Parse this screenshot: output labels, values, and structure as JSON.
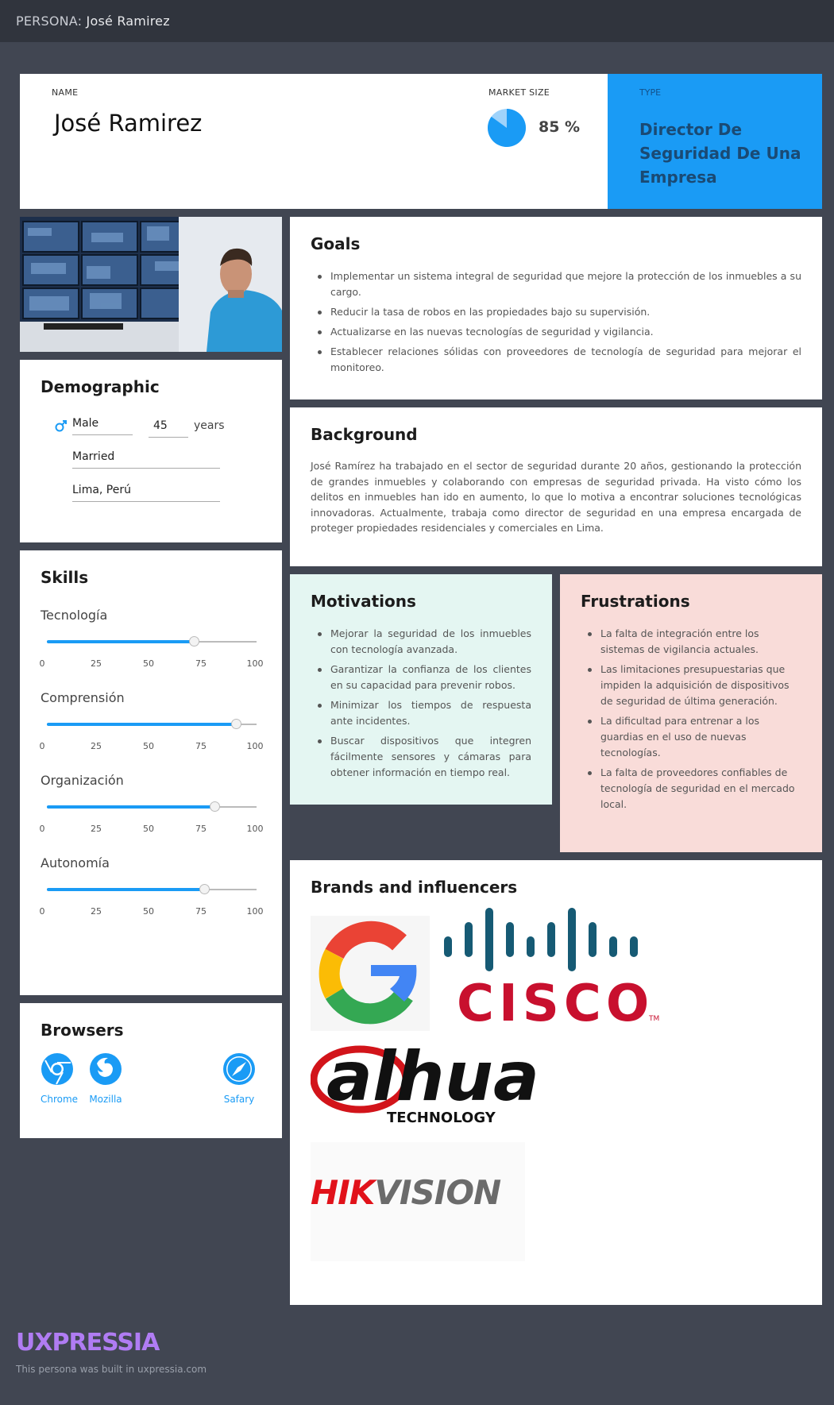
{
  "topbar": {
    "prefix": "PERSONA:",
    "name": "José Ramirez"
  },
  "header": {
    "name_label": "NAME",
    "name": "José Ramirez",
    "market_label": "MARKET SIZE",
    "market_value": "85 %",
    "market_fraction": 0.85,
    "type_label": "TYPE",
    "type_value": "Director De Seguridad De Una Empresa"
  },
  "goals": {
    "title": "Goals",
    "items": [
      "Implementar un sistema integral de seguridad que mejore la protección de los inmuebles a su cargo.",
      "Reducir la tasa de robos en las propiedades bajo su supervisión.",
      "Actualizarse en las nuevas tecnologías de seguridad y vigilancia.",
      "Establecer relaciones sólidas con proveedores de tecnología de seguridad para mejorar el monitoreo."
    ]
  },
  "background": {
    "title": "Background",
    "text": "José Ramírez ha trabajado en el sector de seguridad durante 20 años, gestionando la protección de grandes inmuebles y colaborando con empresas de seguridad privada. Ha visto cómo los delitos en inmuebles han ido en aumento, lo que lo motiva a encontrar soluciones tecnológicas innovadoras. Actualmente, trabaja como director de seguridad en una empresa encargada de proteger propiedades residenciales y comerciales en Lima."
  },
  "motivations": {
    "title": "Motivations",
    "items": [
      "Mejorar la seguridad de los inmuebles con tecnología avanzada.",
      "Garantizar la confianza de los clientes en su capacidad para prevenir robos.",
      "Minimizar los tiempos de respuesta ante incidentes.",
      "Buscar dispositivos que integren fácilmente sensores y cámaras para obtener información en tiempo real."
    ]
  },
  "frustrations": {
    "title": "Frustrations",
    "items": [
      "La falta de integración entre los sistemas de vigilancia actuales.",
      "Las limitaciones presupuestarias que impiden la adquisición de dispositivos de seguridad de última generación.",
      "La dificultad para entrenar a los guardias en el uso de nuevas tecnologías.",
      "La falta de proveedores confiables de tecnología de seguridad en el mercado local."
    ]
  },
  "brands": {
    "title": "Brands and influencers",
    "logos": [
      "google-logo",
      "cisco-logo",
      "dahua-logo",
      "hikvision-logo"
    ],
    "cisco_text": "CISCO",
    "cisco_tm": "TM",
    "dahua_text": "alhua",
    "dahua_sub": "TECHNOLOGY",
    "hik_red": "HIK",
    "hik_gray": "VISION"
  },
  "demographic": {
    "title": "Demographic",
    "gender": "Male",
    "gender_icon": "male-icon",
    "age": "45",
    "age_unit": "years",
    "status": "Married",
    "location": "Lima, Perú"
  },
  "skills": {
    "title": "Skills",
    "ticks": [
      "0",
      "25",
      "50",
      "75",
      "100"
    ],
    "items": [
      {
        "name": "Tecnología",
        "value": 70
      },
      {
        "name": "Comprensión",
        "value": 90
      },
      {
        "name": "Organización",
        "value": 80
      },
      {
        "name": "Autonomía",
        "value": 75
      }
    ]
  },
  "browsers": {
    "title": "Browsers",
    "items": [
      {
        "label": "Chrome",
        "icon": "chrome-icon"
      },
      {
        "label": "Mozilla",
        "icon": "firefox-icon"
      },
      {
        "label": "Safary",
        "icon": "safari-icon"
      }
    ]
  },
  "colors": {
    "accent": "#1a9bf5",
    "motivations_bg": "#e4f6f2",
    "frustrations_bg": "#f9dcd9",
    "brand": "#b07cf3"
  },
  "footer": {
    "logo": "UXPRESSIA",
    "note": "This persona was built in uxpressia.com"
  }
}
